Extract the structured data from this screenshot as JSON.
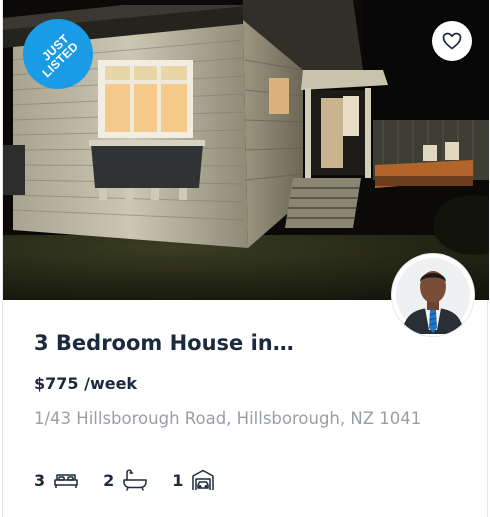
{
  "listing": {
    "badge": {
      "line1": "JUST",
      "line2": "LISTED"
    },
    "title": "3 Bedroom House in…",
    "price": "$775 /week",
    "address": "1/43 Hillsborough Road, Hillsborough, NZ 1041",
    "features": [
      {
        "value": "3",
        "icon": "bed-icon"
      },
      {
        "value": "2",
        "icon": "bathtub-icon"
      },
      {
        "value": "1",
        "icon": "garage-icon"
      }
    ]
  },
  "colors": {
    "badge": "#1a9be6",
    "heading_text": "#1b2a3d",
    "address_text": "#9a9ea4",
    "agent_suit": "#2a2f36",
    "agent_tie": "#1f77c8"
  },
  "icons": {
    "favorite": "heart-outline-icon"
  }
}
